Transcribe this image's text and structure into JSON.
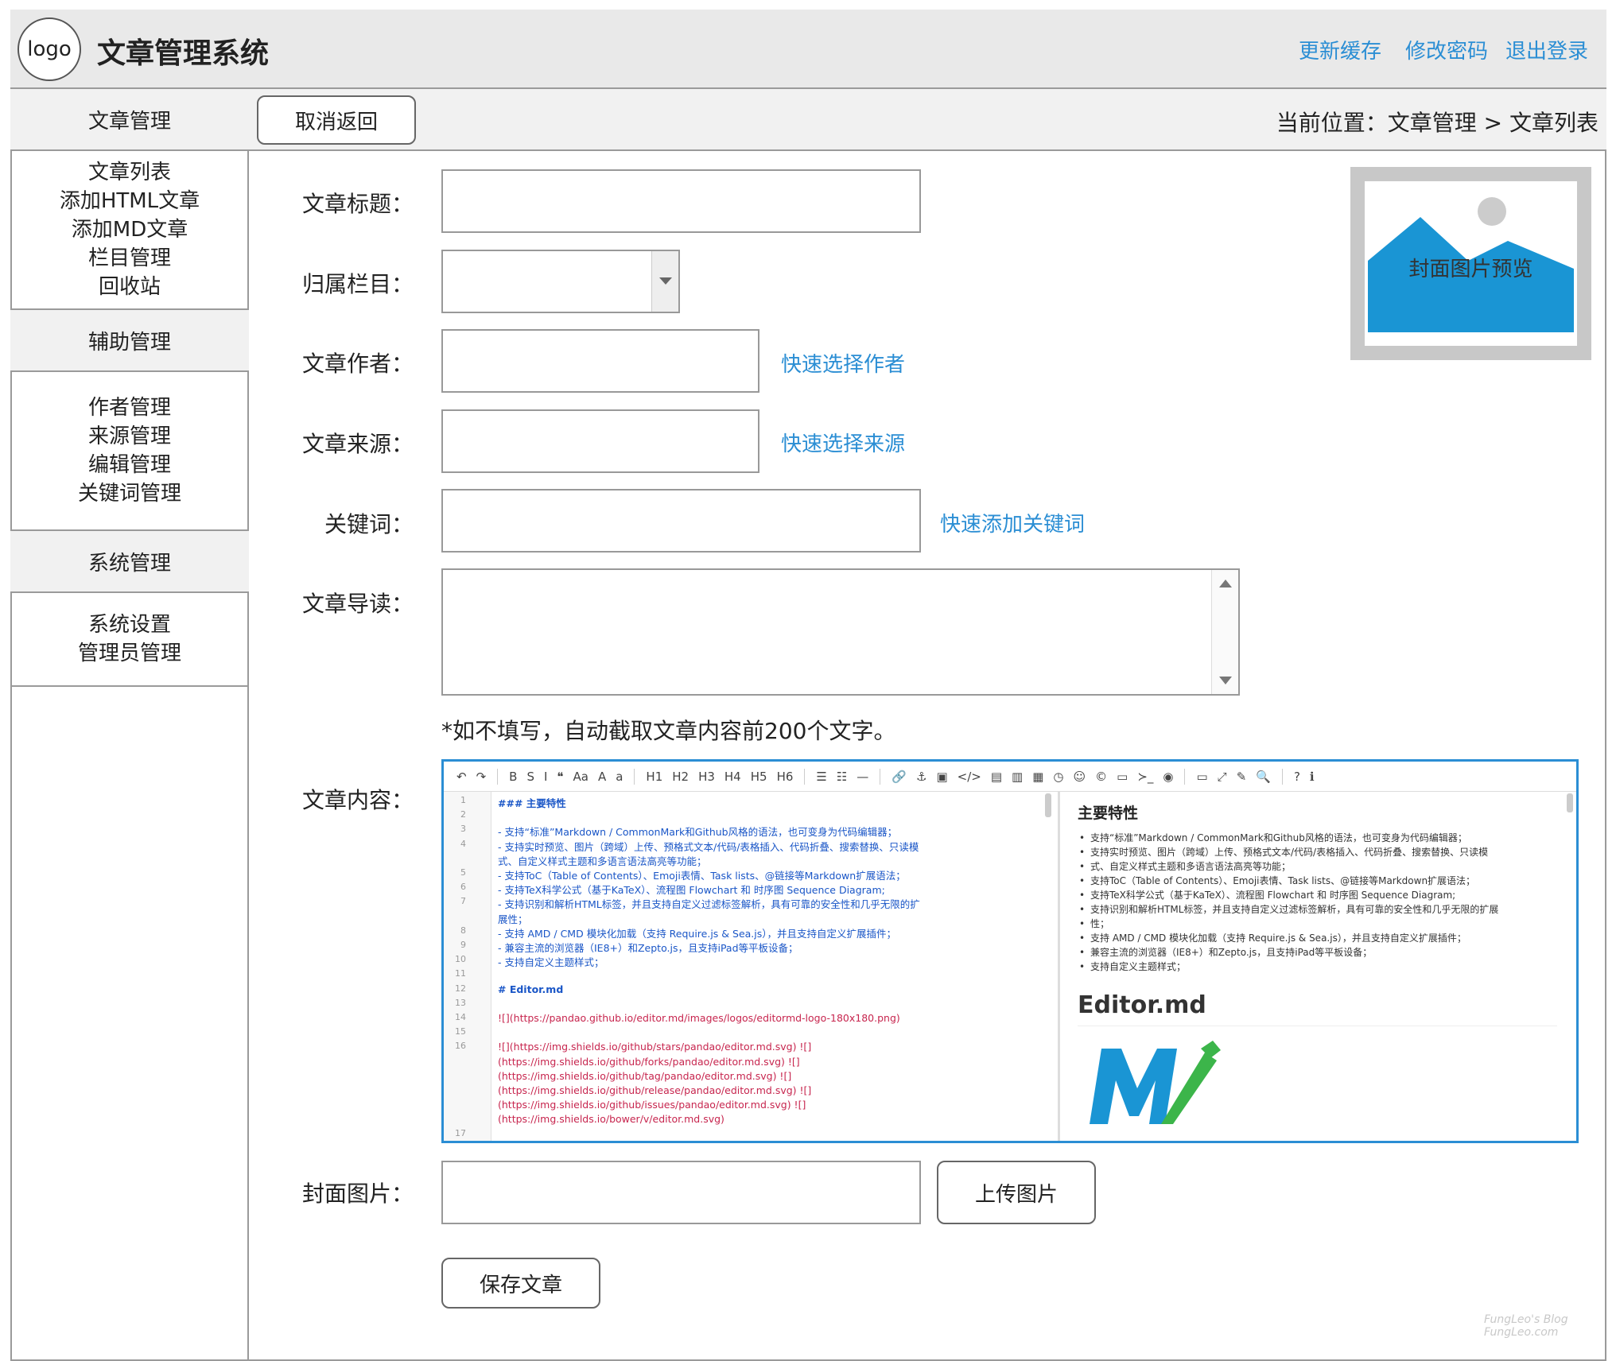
{
  "app": {
    "logo_text": "logo",
    "title": "文章管理系统"
  },
  "header_links": [
    "更新缓存",
    "修改密码",
    "退出登录"
  ],
  "sidebar": {
    "sections": [
      {
        "title": "文章管理",
        "items": [
          "文章列表",
          "添加HTML文章",
          "添加MD文章",
          "栏目管理",
          "回收站"
        ]
      },
      {
        "title": "辅助管理",
        "items": [
          "作者管理",
          "来源管理",
          "编辑管理",
          "关键词管理"
        ]
      },
      {
        "title": "系统管理",
        "items": [
          "系统设置",
          "管理员管理"
        ]
      }
    ]
  },
  "topbar": {
    "back_button": "取消返回",
    "breadcrumb": "当前位置：文章管理 > 文章列表"
  },
  "form": {
    "title_label": "文章标题：",
    "category_label": "归属栏目：",
    "author_label": "文章作者：",
    "author_link": "快速选择作者",
    "source_label": "文章来源：",
    "source_link": "快速选择来源",
    "keywords_label": "关键词：",
    "keywords_link": "快速添加关键词",
    "intro_label": "文章导读：",
    "intro_hint": "*如不填写，自动截取文章内容前200个文字。",
    "content_label": "文章内容：",
    "cover_label": "封面图片：",
    "upload_button": "上传图片",
    "save_button": "保存文章",
    "cover_preview_text": "封面图片预览"
  },
  "editor": {
    "toolbar": [
      "↶",
      "↷",
      "B",
      "S",
      "I",
      "❝",
      "Aa",
      "A",
      "a",
      "H1",
      "H2",
      "H3",
      "H4",
      "H5",
      "H6",
      "☰",
      "☷",
      "—",
      "🔗",
      "⚓",
      "▣",
      "</>",
      "▤",
      "▥",
      "▦",
      "◷",
      "☺",
      "©",
      "▭",
      "≻_",
      "◉",
      "▭",
      "⤢",
      "✎",
      "🔍",
      "?",
      "ℹ"
    ],
    "line_numbers": [
      "1",
      "2",
      "3",
      "4",
      "",
      "5",
      "6",
      "7",
      "",
      "8",
      "9",
      "10",
      "11",
      "12",
      "13",
      "14",
      "15",
      "16",
      "",
      "",
      "",
      "",
      "",
      "17"
    ],
    "code_lines": [
      {
        "t": "### 主要特性",
        "c": "bold"
      },
      {
        "t": "",
        "c": ""
      },
      {
        "t": "- 支持“标准”Markdown / CommonMark和Github风格的语法，也可变身为代码编辑器；",
        "c": ""
      },
      {
        "t": "- 支持实时预览、图片（跨域）上传、预格式文本/代码/表格插入、代码折叠、搜索替换、只读模",
        "c": ""
      },
      {
        "t": "式、自定义样式主题和多语言语法高亮等功能；",
        "c": ""
      },
      {
        "t": "- 支持ToC（Table of Contents）、Emoji表情、Task lists、@链接等Markdown扩展语法；",
        "c": ""
      },
      {
        "t": "- 支持TeX科学公式（基于KaTeX）、流程图 Flowchart 和 时序图 Sequence Diagram;",
        "c": ""
      },
      {
        "t": "- 支持识别和解析HTML标签，并且支持自定义过滤标签解析，具有可靠的安全性和几乎无限的扩",
        "c": ""
      },
      {
        "t": "展性；",
        "c": ""
      },
      {
        "t": "- 支持 AMD / CMD 模块化加载（支持 Require.js & Sea.js），并且支持自定义扩展插件；",
        "c": ""
      },
      {
        "t": "- 兼容主流的浏览器（IE8+）和Zepto.js，且支持iPad等平板设备；",
        "c": ""
      },
      {
        "t": "- 支持自定义主题样式；",
        "c": ""
      },
      {
        "t": "",
        "c": ""
      },
      {
        "t": "# Editor.md",
        "c": "bold"
      },
      {
        "t": "",
        "c": ""
      },
      {
        "t": "![](https://pandao.github.io/editor.md/images/logos/editormd-logo-180x180.png)",
        "c": "red"
      },
      {
        "t": "",
        "c": ""
      },
      {
        "t": "![](https://img.shields.io/github/stars/pandao/editor.md.svg) ![]",
        "c": "red"
      },
      {
        "t": "(https://img.shields.io/github/forks/pandao/editor.md.svg) ![]",
        "c": "red"
      },
      {
        "t": "(https://img.shields.io/github/tag/pandao/editor.md.svg) ![]",
        "c": "red"
      },
      {
        "t": "(https://img.shields.io/github/release/pandao/editor.md.svg) ![]",
        "c": "red"
      },
      {
        "t": "(https://img.shields.io/github/issues/pandao/editor.md.svg) ![]",
        "c": "red"
      },
      {
        "t": "(https://img.shields.io/bower/v/editor.md.svg)",
        "c": "red"
      }
    ],
    "preview": {
      "heading": "主要特性",
      "items": [
        "支持“标准”Markdown / CommonMark和Github风格的语法，也可变身为代码编辑器；",
        "支持实时预览、图片（跨域）上传、预格式文本/代码/表格插入、代码折叠、搜索替换、只读模",
        "式、自定义样式主题和多语言语法高亮等功能；",
        "支持ToC（Table of Contents）、Emoji表情、Task lists、@链接等Markdown扩展语法；",
        "支持TeX科学公式（基于KaTeX）、流程图 Flowchart 和 时序图 Sequence Diagram;",
        "支持识别和解析HTML标签，并且支持自定义过滤标签解析，具有可靠的安全性和几乎无限的扩展",
        "性；",
        "支持 AMD / CMD 模块化加载（支持 Require.js & Sea.js），并且支持自定义扩展插件；",
        "兼容主流的浏览器（IE8+）和Zepto.js，且支持iPad等平板设备；",
        "支持自定义主题样式；"
      ],
      "title": "Editor.md"
    }
  },
  "watermark": {
    "line1": "FungLeo's Blog",
    "line2": "FungLeo.com"
  },
  "colors": {
    "accent": "#2b8ed4",
    "preview_blue": "#1a95d4"
  }
}
